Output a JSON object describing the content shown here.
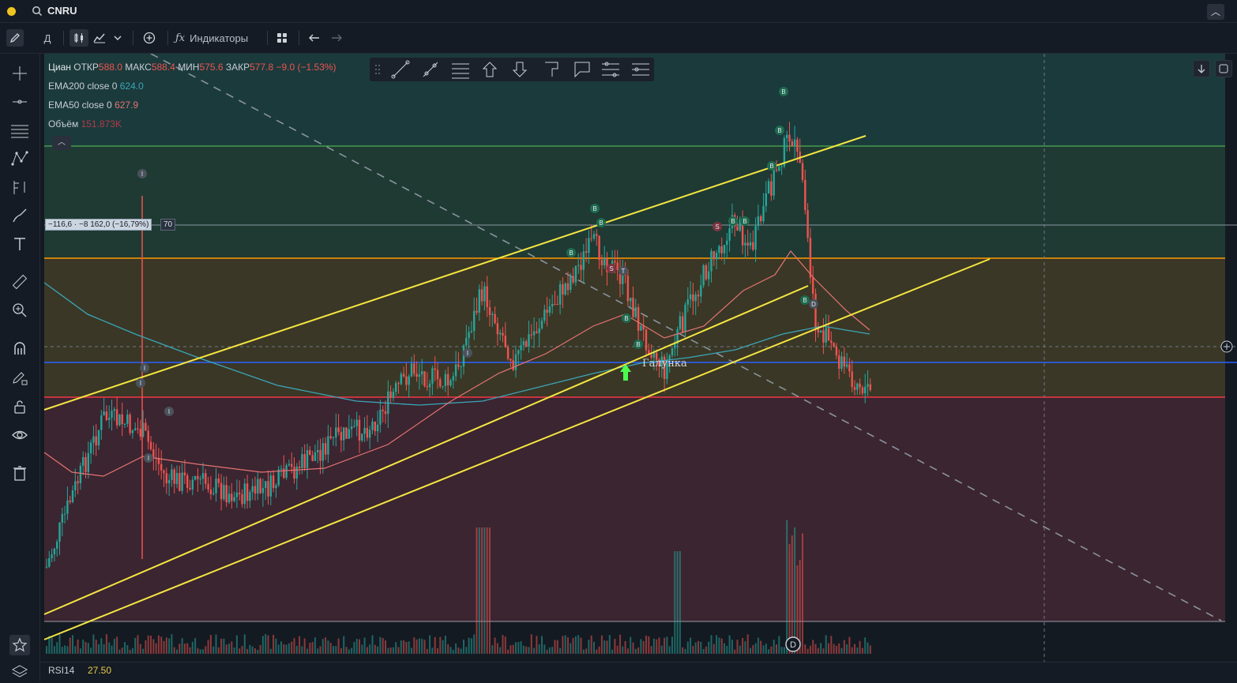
{
  "topbar": {
    "symbol": "CNRU"
  },
  "toolbar": {
    "interval_label": "Д",
    "indicators_label": "Индикаторы"
  },
  "legend": {
    "main": {
      "name": "Циан",
      "open_label": "ОТКР",
      "open": "588.0",
      "high_label": "МАКС",
      "high": "588.4",
      "low_label": "МИН",
      "low": "575.6",
      "close_label": "ЗАКР",
      "close": "577.8",
      "change": "−9.0 (−1.53%)"
    },
    "ema200": {
      "label": "EMA200 close 0",
      "value": "624.0"
    },
    "ema50": {
      "label": "EMA50 close 0",
      "value": "627.9"
    },
    "volume": {
      "label": "Объём",
      "value": "151.873K"
    }
  },
  "measure": {
    "text": "−116,6 · −8 162,0 (−16,79%)",
    "bars": "70"
  },
  "rsi": {
    "label": "RSI14",
    "value": "27.50"
  },
  "annotation": {
    "text": "Галунка"
  },
  "colors": {
    "bull": "#26a69a",
    "bear": "#ef5350",
    "channel": "#f5e642",
    "green_level": "#4caf50",
    "orange_level": "#ff9800",
    "blue_level": "#2962ff",
    "red_level": "#f23645",
    "ema200": "#3aa6b9",
    "ema50": "#e57373"
  },
  "icons": [
    "search-icon",
    "pencil-icon",
    "candles-icon",
    "area-chart-icon",
    "chevron-down-icon",
    "plus-circle-icon",
    "fx-icon",
    "grid-icon",
    "undo-icon",
    "redo-icon",
    "crosshair-icon",
    "trend-line-icon",
    "horizontal-lines-icon",
    "pattern-icon",
    "fork-icon",
    "brush-icon",
    "text-icon",
    "ruler-icon",
    "zoom-icon",
    "magnet-icon",
    "lock-pencil-icon",
    "lock-icon",
    "eye-icon",
    "trash-icon",
    "star-icon",
    "layers-icon"
  ]
}
